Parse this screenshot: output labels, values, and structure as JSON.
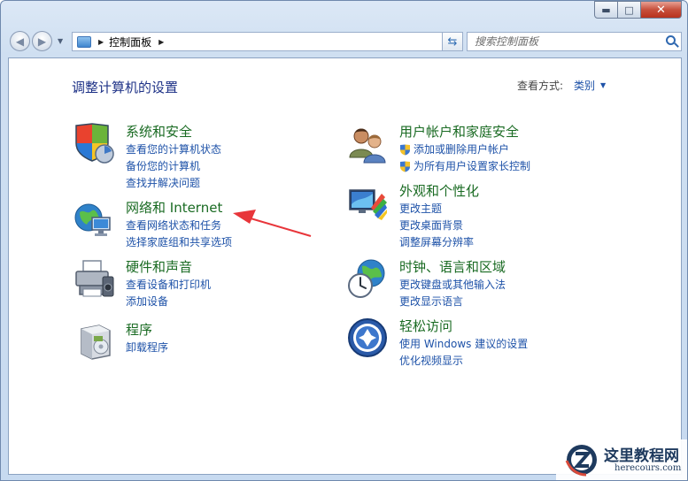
{
  "window": {
    "minimize_icon": "minimize-icon",
    "maximize_icon": "maximize-icon",
    "close_icon": "close-icon"
  },
  "address_bar": {
    "path": "控制面板",
    "back_icon": "back-arrow-icon",
    "forward_icon": "forward-arrow-icon",
    "refresh_icon": "refresh-icon"
  },
  "search": {
    "placeholder": "搜索控制面板"
  },
  "main": {
    "title": "调整计算机的设置",
    "view_by_label": "查看方式:",
    "view_by_value": "类别"
  },
  "categories": {
    "system": {
      "title": "系统和安全",
      "links": [
        "查看您的计算机状态",
        "备份您的计算机",
        "查找并解决问题"
      ]
    },
    "network": {
      "title": "网络和 Internet",
      "links": [
        "查看网络状态和任务",
        "选择家庭组和共享选项"
      ]
    },
    "hardware": {
      "title": "硬件和声音",
      "links": [
        "查看设备和打印机",
        "添加设备"
      ]
    },
    "programs": {
      "title": "程序",
      "links": [
        "卸载程序"
      ]
    },
    "users": {
      "title": "用户帐户和家庭安全",
      "links": [
        "添加或删除用户帐户",
        "为所有用户设置家长控制"
      ]
    },
    "appearance": {
      "title": "外观和个性化",
      "links": [
        "更改主题",
        "更改桌面背景",
        "调整屏幕分辨率"
      ]
    },
    "clock": {
      "title": "时钟、语言和区域",
      "links": [
        "更改键盘或其他输入法",
        "更改显示语言"
      ]
    },
    "ease": {
      "title": "轻松访问",
      "links": [
        "使用 Windows 建议的设置",
        "优化视频显示"
      ]
    }
  },
  "colors": {
    "category_title": "#1a6b23",
    "link": "#1e52a8",
    "annotation_arrow": "#e8353a"
  },
  "watermark": {
    "name": "这里教程网",
    "url": "herecours.com"
  }
}
